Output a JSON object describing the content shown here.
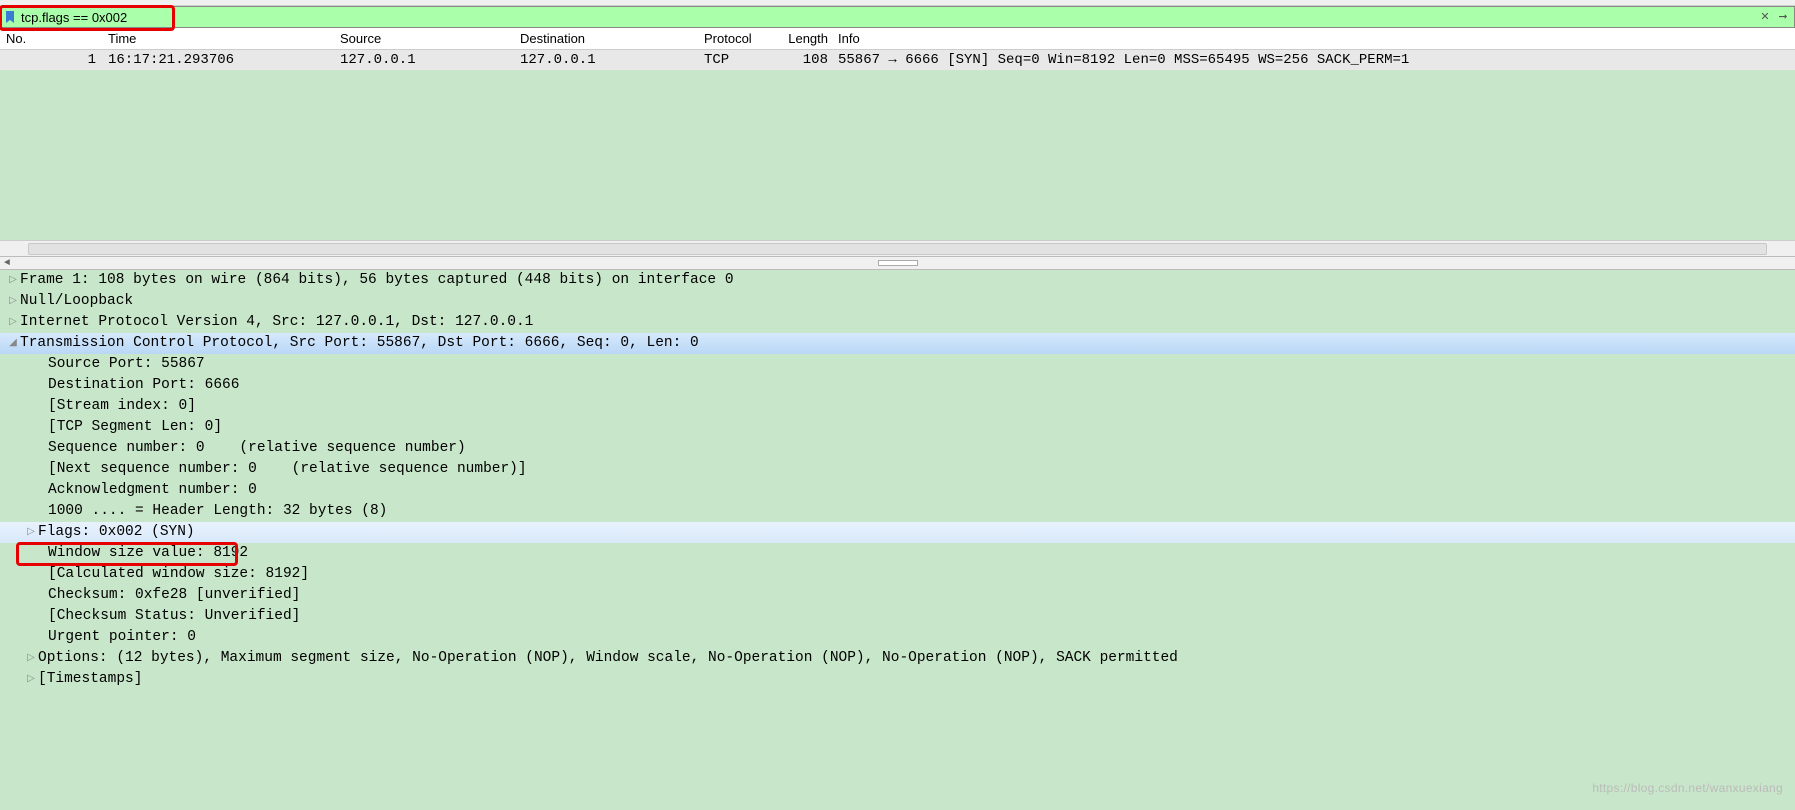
{
  "filter": {
    "value": "tcp.flags == 0x002"
  },
  "columns": {
    "no": "No.",
    "time": "Time",
    "source": "Source",
    "destination": "Destination",
    "protocol": "Protocol",
    "length": "Length",
    "info": "Info"
  },
  "packets": [
    {
      "no": "1",
      "time": "16:17:21.293706",
      "source": "127.0.0.1",
      "destination": "127.0.0.1",
      "protocol": "TCP",
      "length": "108",
      "info": "55867 → 6666 [SYN] Seq=0 Win=8192 Len=0 MSS=65495 WS=256 SACK_PERM=1"
    }
  ],
  "details": {
    "frame": "Frame 1: 108 bytes on wire (864 bits), 56 bytes captured (448 bits) on interface 0",
    "null_loopback": "Null/Loopback",
    "ip": "Internet Protocol Version 4, Src: 127.0.0.1, Dst: 127.0.0.1",
    "tcp": "Transmission Control Protocol, Src Port: 55867, Dst Port: 6666, Seq: 0, Len: 0",
    "tcp_children": {
      "src_port": "Source Port: 55867",
      "dst_port": "Destination Port: 6666",
      "stream_idx": "[Stream index: 0]",
      "seg_len": "[TCP Segment Len: 0]",
      "seq": "Sequence number: 0    (relative sequence number)",
      "next_seq": "[Next sequence number: 0    (relative sequence number)]",
      "ack": "Acknowledgment number: 0",
      "hdr_len": "1000 .... = Header Length: 32 bytes (8)",
      "flags": "Flags: 0x002 (SYN)",
      "win": "Window size value: 8192",
      "calc_win": "[Calculated window size: 8192]",
      "checksum": "Checksum: 0xfe28 [unverified]",
      "checksum_status": "[Checksum Status: Unverified]",
      "urgent": "Urgent pointer: 0",
      "options": "Options: (12 bytes), Maximum segment size, No-Operation (NOP), Window scale, No-Operation (NOP), No-Operation (NOP), SACK permitted",
      "timestamps": "[Timestamps]"
    }
  },
  "watermark": "https://blog.csdn.net/wanxuexiang"
}
